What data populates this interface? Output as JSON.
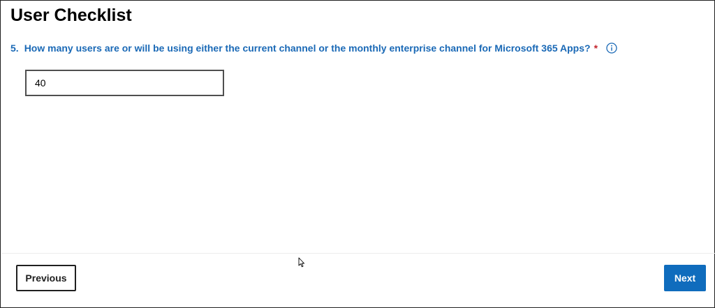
{
  "page": {
    "title": "User Checklist"
  },
  "question": {
    "number": "5.",
    "text": "How many users are or will be using either the current channel or the monthly enterprise channel for Microsoft 365 Apps?",
    "required_marker": "*",
    "info_icon": "info-circle-icon",
    "answer_value": "40"
  },
  "footer": {
    "previous_label": "Previous",
    "next_label": "Next"
  },
  "colors": {
    "question_text": "#1a69b6",
    "required": "#c4262e",
    "primary_button": "#0f6cbd",
    "border": "#1f1f1f"
  }
}
